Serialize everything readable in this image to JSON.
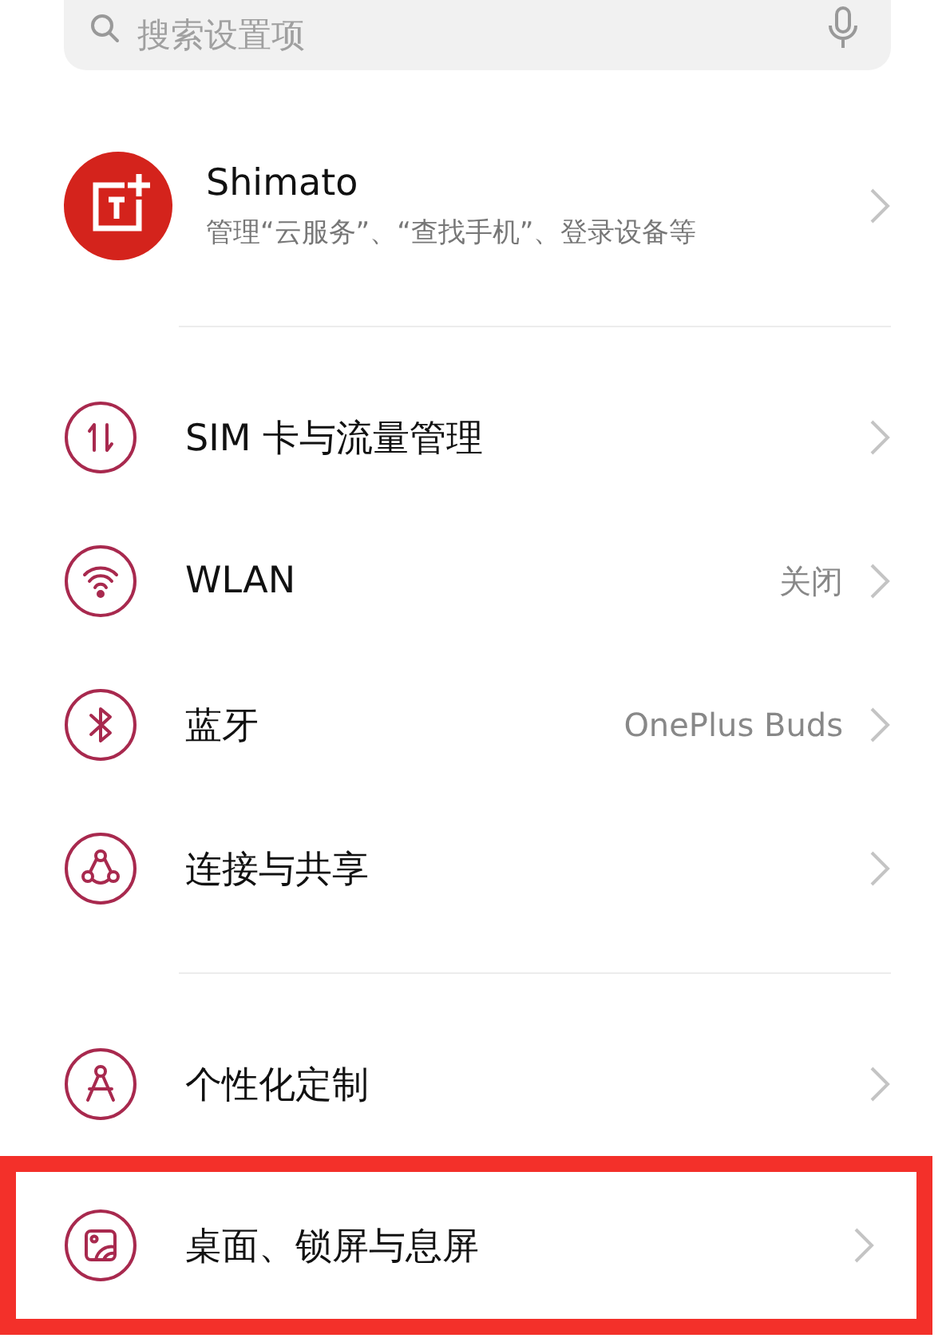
{
  "search": {
    "placeholder": "搜索设置项"
  },
  "account": {
    "name": "Shimato",
    "subtitle": "管理“云服务”、“查找手机”、登录设备等"
  },
  "groups": [
    {
      "items": [
        {
          "kind": "sim",
          "label": "SIM 卡与流量管理",
          "highlighted": false
        },
        {
          "kind": "wifi",
          "label": "WLAN",
          "value": "关闭",
          "highlighted": false
        },
        {
          "kind": "bluetooth",
          "label": "蓝牙",
          "value": "OnePlus Buds",
          "highlighted": false
        },
        {
          "kind": "share",
          "label": "连接与共享",
          "highlighted": false
        }
      ]
    },
    {
      "items": [
        {
          "kind": "compass",
          "label": "个性化定制",
          "highlighted": false
        },
        {
          "kind": "wallpaper",
          "label": "桌面、锁屏与息屏",
          "highlighted": true
        }
      ]
    }
  ]
}
